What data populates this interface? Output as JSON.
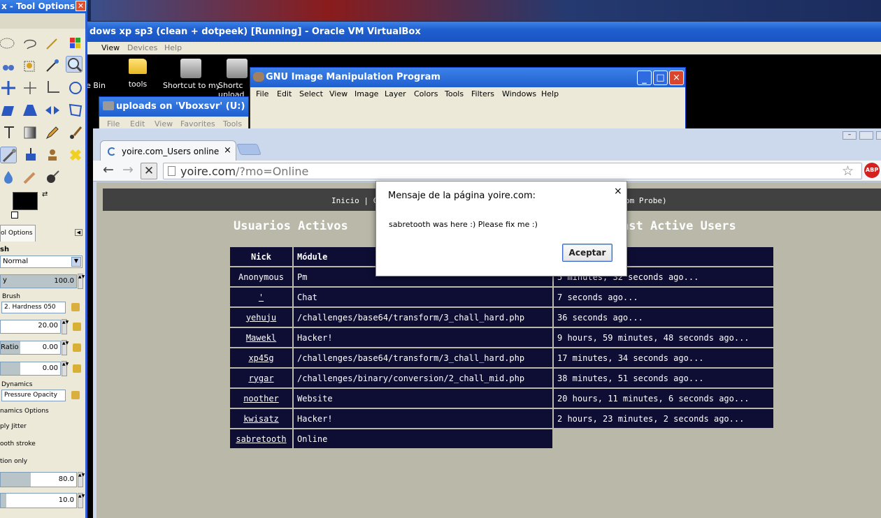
{
  "vbox": {
    "title": "dows xp sp3 (clean + dotpeek) [Running] - Oracle VM VirtualBox",
    "menu": [
      "View",
      "Devices",
      "Help"
    ]
  },
  "desktop": {
    "icons": [
      {
        "label": "e Bin",
        "icon": "recycle-bin-icon"
      },
      {
        "label": "tools",
        "icon": "folder-icon"
      },
      {
        "label": "Shortcut to myuscsrpa...",
        "icon": "network-drive-icon"
      },
      {
        "label": "Shortc upload",
        "icon": "network-drive-icon"
      }
    ]
  },
  "gimp": {
    "title": "GNU Image Manipulation Program",
    "menu": [
      "File",
      "Edit",
      "Select",
      "View",
      "Image",
      "Layer",
      "Colors",
      "Tools",
      "Filters",
      "Windows",
      "Help"
    ]
  },
  "uploads": {
    "title": "uploads on 'Vboxsvr' (U:)",
    "menu": [
      "File",
      "Edit",
      "View",
      "Favorites",
      "Tools"
    ]
  },
  "browser": {
    "tab_title": "yoire.com_Users online",
    "url_host": "yoire.com",
    "url_path": "/?mo=Online",
    "abp": "ABP"
  },
  "page": {
    "nav_left": "Inicio | C",
    "nav_right": "om Probe)",
    "heading_es": "Usuarios Activos",
    "heading_en": "ast Active Users",
    "columns": [
      "Nick",
      "Módule",
      "."
    ],
    "rows": [
      {
        "nick": "Anonymous",
        "link": false,
        "module": "Pm",
        "time": "5 minutes, 32 seconds ago..."
      },
      {
        "nick": "'",
        "link": true,
        "module": "Chat",
        "time": "7 seconds ago..."
      },
      {
        "nick": "yehuju",
        "link": true,
        "module": "/challenges/base64/transform/3_chall_hard.php",
        "time": "36 seconds ago..."
      },
      {
        "nick": "Mawekl",
        "link": true,
        "module": "Hacker!",
        "time": "9 hours, 59 minutes, 48 seconds ago..."
      },
      {
        "nick": "xp45g",
        "link": true,
        "module": "/challenges/base64/transform/3_chall_hard.php",
        "time": "17 minutes, 34 seconds ago..."
      },
      {
        "nick": "rygar",
        "link": true,
        "module": "/challenges/binary/conversion/2_chall_mid.php",
        "time": "38 minutes, 51 seconds ago..."
      },
      {
        "nick": "noother",
        "link": true,
        "module": "Website",
        "time": "20 hours, 11 minutes, 6 seconds ago..."
      },
      {
        "nick": "kwisatz",
        "link": true,
        "module": "Hacker!",
        "time": "2 hours, 23 minutes, 2 seconds ago..."
      },
      {
        "nick": "sabretooth",
        "link": true,
        "module": "Online",
        "time": ""
      }
    ]
  },
  "dialog": {
    "title": "Mensaje de la página yoire.com:",
    "message": "sabretooth was here :) Please fix me :)",
    "button": "Aceptar",
    "close": "×"
  },
  "toolbox": {
    "title": "x - Tool Options",
    "tab": "ol Options",
    "section": "sh",
    "mode": "Normal",
    "opacity_label": "y",
    "opacity": "100.0",
    "brush_label": "Brush",
    "brush": "2. Hardness 050",
    "size": "20.00",
    "ratio_label": "Ratio",
    "ratio": "0.00",
    "angle": "0.00",
    "dynamics_label": "Dynamics",
    "dynamics": "Pressure Opacity",
    "dynamics_options": "namics Options",
    "apply_jitter": "ply Jitter",
    "smooth_stroke": "ooth stroke",
    "motion_only": "tion only",
    "quality": "80.0",
    "weight": "10.0"
  }
}
